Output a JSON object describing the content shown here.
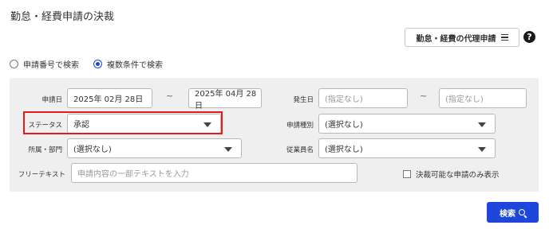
{
  "page": {
    "title": "勤怠・経費申請の決裁"
  },
  "header": {
    "proxy_button": "勤怠・経費の代理申請",
    "help_icon": "?"
  },
  "search_mode": {
    "options": [
      "申請番号で検索",
      "複数条件で検索"
    ],
    "selected": "複数条件で検索"
  },
  "filters": {
    "date_label": "申請日",
    "date_from": "2025年 02月 28日",
    "date_to": "2025年 04月 28日",
    "tilde": "~",
    "occur_label": "発生日",
    "occur_from_placeholder": "(指定なし)",
    "occur_to_placeholder": "(指定なし)",
    "status_label": "ステータス",
    "status_value": "承認",
    "type_label": "申請種別",
    "type_value": "(選択なし)",
    "dept_label": "所属・部門",
    "dept_value": "(選択なし)",
    "employee_label": "従業員名",
    "employee_value": "(選択なし)",
    "freetext_label": "フリーテキスト",
    "freetext_placeholder": "申請内容の一部テキストを入力",
    "checkbox_label": "決裁可能な申請のみ表示"
  },
  "actions": {
    "search_button": "検索"
  },
  "colors": {
    "accent": "#1f46db",
    "highlight": "#e8191d",
    "panel": "#efefef"
  }
}
